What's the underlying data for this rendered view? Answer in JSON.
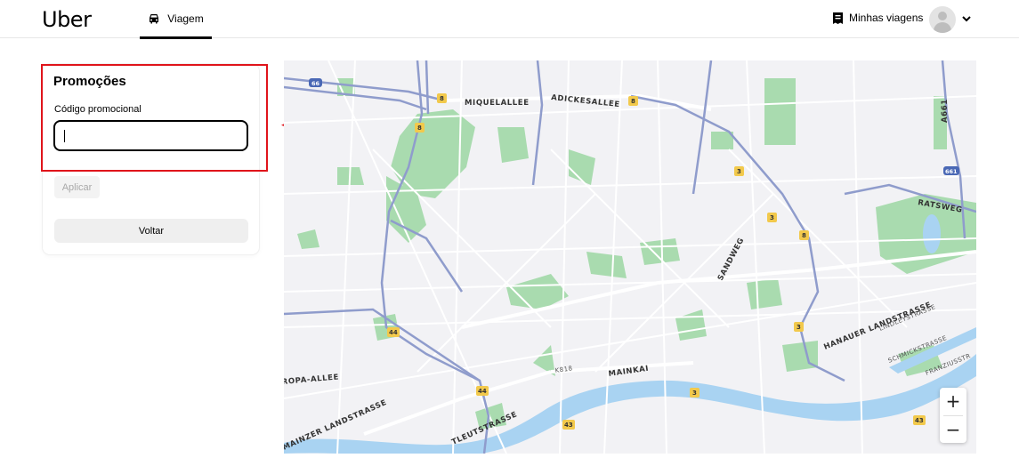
{
  "header": {
    "logo": "Uber",
    "tab_label": "Viagem",
    "my_trips_label": "Minhas viagens"
  },
  "promo": {
    "title": "Promoções",
    "field_label": "Código promocional",
    "input_value": "",
    "apply_label": "Aplicar",
    "back_label": "Voltar"
  },
  "map": {
    "labels": {
      "miquelallee": "MIQUELALLEE",
      "adickesallee": "ADICKESALLEE",
      "ratsweg": "RATSWEG",
      "sandweg": "SANDWEG",
      "hanauer": "HANAUER LANDSTRASSE",
      "lindley": "LINDLEYSTRASSE",
      "schmick": "SCHMICKSTRASSE",
      "franzius": "FRANZIUSSTR",
      "mainkai": "MAINKAI",
      "k818": "K818",
      "europa": "ROPA-ALLEE",
      "mainzer": "MAINZER LANDSTRASSE",
      "gutleut": "TLEUTSTRASSE",
      "a661": "A661"
    },
    "shields": {
      "s66": "66",
      "s661": "661",
      "s8": "8",
      "s3": "3",
      "s44": "44",
      "s43": "43"
    },
    "zoom_in": "+",
    "zoom_out": "−"
  },
  "colors": {
    "highlight": "#e0141b",
    "water": "#a9d3f2",
    "park": "#a9dbaf",
    "highway": "#8f9ccc"
  }
}
